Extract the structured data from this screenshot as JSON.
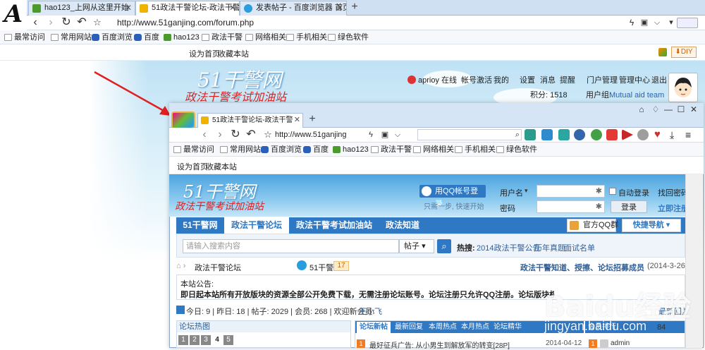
{
  "outer": {
    "tabs": [
      {
        "label": "hao123_上网从这里开始",
        "icon_color": "#4b9a2e"
      },
      {
        "label": "51政法干警论坛-政法干警",
        "icon_color": "#f0b400"
      },
      {
        "label": "发表帖子 - 百度浏览器 首页",
        "icon_color": "#2a9ddf"
      }
    ],
    "new_tab": "+",
    "url": "http://www.51ganjing.com/forum.php",
    "bookmarks": [
      "最常访问",
      "常用网站",
      "百度浏览",
      "百度",
      "hao123",
      "政法干警",
      "网络相关",
      "手机相关",
      "绿色软件"
    ],
    "toolbar": {
      "set_home": "设为首页",
      "favorite": "收藏本站",
      "diy": "⬇DIY"
    },
    "brand": "51干警网",
    "slogan": "政法干警考试加油站",
    "user_menu": [
      "aprioy",
      "在线",
      "帐号激活",
      "我的",
      "设置",
      "消息",
      "提醒",
      "门户管理",
      "管理中心",
      "退出"
    ],
    "points_label": "积分: 1518",
    "group_label": "用户组:",
    "group_value": "Mutual aid team"
  },
  "inner": {
    "tab": "51政法干警论坛-政法干警",
    "new_tab": "+",
    "url": "http://www.51ganjing",
    "bookmarks": [
      "最常访问",
      "常用网站",
      "百度浏览",
      "百度",
      "hao123",
      "政法干警",
      "网络相关",
      "手机相关",
      "绿色软件"
    ],
    "toolbar": {
      "set_home": "设为首页",
      "favorite": "收藏本站"
    },
    "brand": "51干警网",
    "slogan": "政法干警考试加油站",
    "qq_login": "用QQ帐号登录",
    "qq_hint": "只需一步, 快速开始",
    "username_label": "用户名",
    "password_label": "密码",
    "auto_login": "自动登录",
    "find_password": "找回密码",
    "login_button": "登录",
    "register": "立即注册",
    "nav": [
      "51干警网",
      "政法干警论坛",
      "政法干警考试加油站",
      "政法知道"
    ],
    "qq_group": "官方QQ群",
    "quick_nav": "快捷导航",
    "search_placeholder": "请输入搜索内容",
    "search_type": "帖子",
    "hot_label": "热搜:",
    "hot_items": [
      "2014政法干警公告",
      "历年真题",
      "面试名单"
    ],
    "crumb": "政法干警论坛",
    "crumb_badge_label": "51干警",
    "crumb_badge_count": "17",
    "announce_link": "政法干警知道、授擦、论坛招募成员啦...",
    "announce_date": "(2014-3-26)",
    "notice_title": "本站公告:",
    "notice_text": "即日起本站所有开放版块的资源全部公开免费下载，无需注册论坛账号。论坛注册只允许QQ注册。论坛版块权限正在调整中...",
    "stats": "今日: 9 | 昨日: 18 | 帖子: 2029 | 会员: 268 | 欢迎新会员:",
    "new_member": "王小飞",
    "latest_reply": "最新回复",
    "hot_title": "论坛热图",
    "pages": [
      "1",
      "2",
      "3",
      "4",
      "5"
    ],
    "news_tabs": [
      "论坛新帖",
      "最新回复",
      "本周热点",
      "本月热点",
      "论坛精华"
    ],
    "rank_title": "会员排行",
    "rank_value": "84",
    "post_title": "最好征兵广告: 从小男生到解放军的转变[28P]",
    "post_date": "2014-04-12",
    "post_badge": "1",
    "post_author": "admin"
  },
  "watermark": {
    "brand": "Baidu经验",
    "url": "jingyan.baidu.com"
  },
  "colors": {
    "accent": "#2f78c4",
    "arrow": "#e02020"
  }
}
